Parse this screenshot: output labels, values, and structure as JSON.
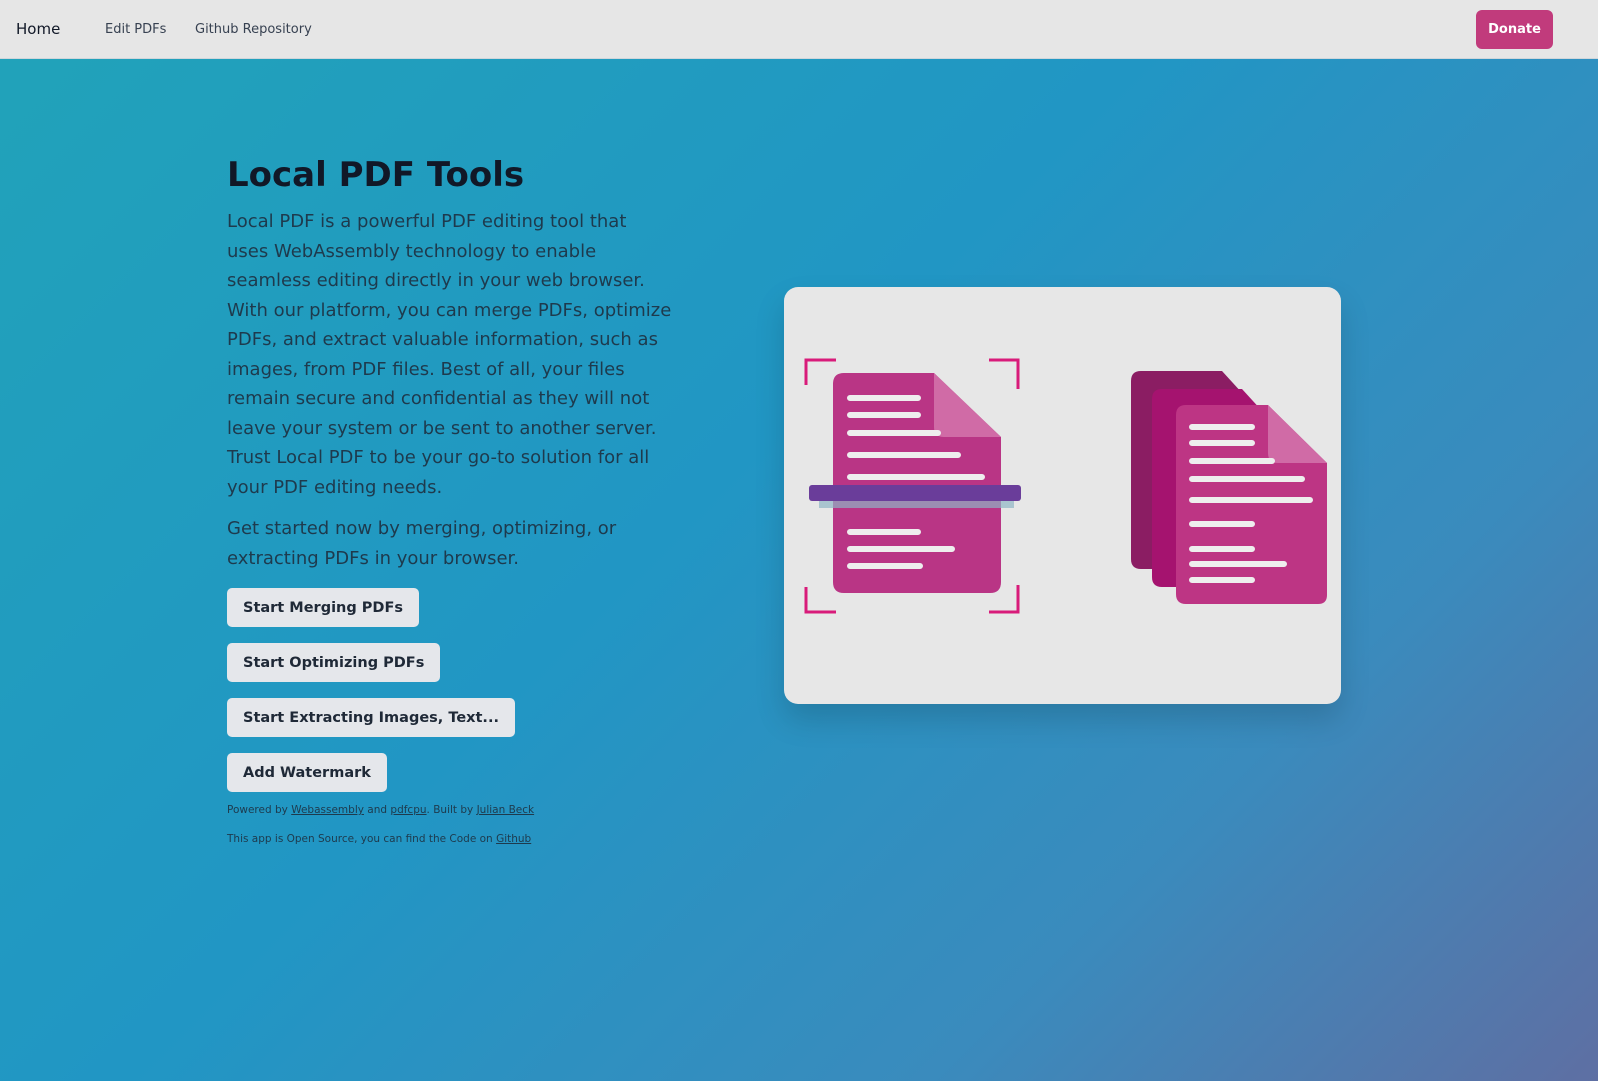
{
  "nav": {
    "home": "Home",
    "edit": "Edit PDFs",
    "github": "Github Repository",
    "donate": "Donate"
  },
  "main": {
    "title": "Local PDF Tools",
    "description": "Local PDF is a powerful PDF editing tool that uses WebAssembly technology to enable seamless editing directly in your web browser. With our platform, you can merge PDFs, optimize PDFs, and extract valuable information, such as images, from PDF files. Best of all, your files remain secure and confidential as they will not leave your system or be sent to another server. Trust Local PDF to be your go-to solution for all your PDF editing needs.",
    "cta": "Get started now by merging, optimizing, or extracting PDFs in your browser.",
    "buttons": [
      "Start Merging PDFs",
      "Start Optimizing PDFs",
      "Start Extracting Images, Text...",
      "Add Watermark"
    ],
    "footer": {
      "powered": "Powered by ",
      "webassembly": "Webassembly",
      "and": " and ",
      "pdfcpu": "pdfcpu",
      "built": ". Built by ",
      "author": "Julian Beck",
      "open": "This app is Open Source, you can find the Code on ",
      "github": "Github"
    }
  },
  "colors": {
    "accent": "#c13b7c",
    "scan": "#6a3d9a"
  }
}
